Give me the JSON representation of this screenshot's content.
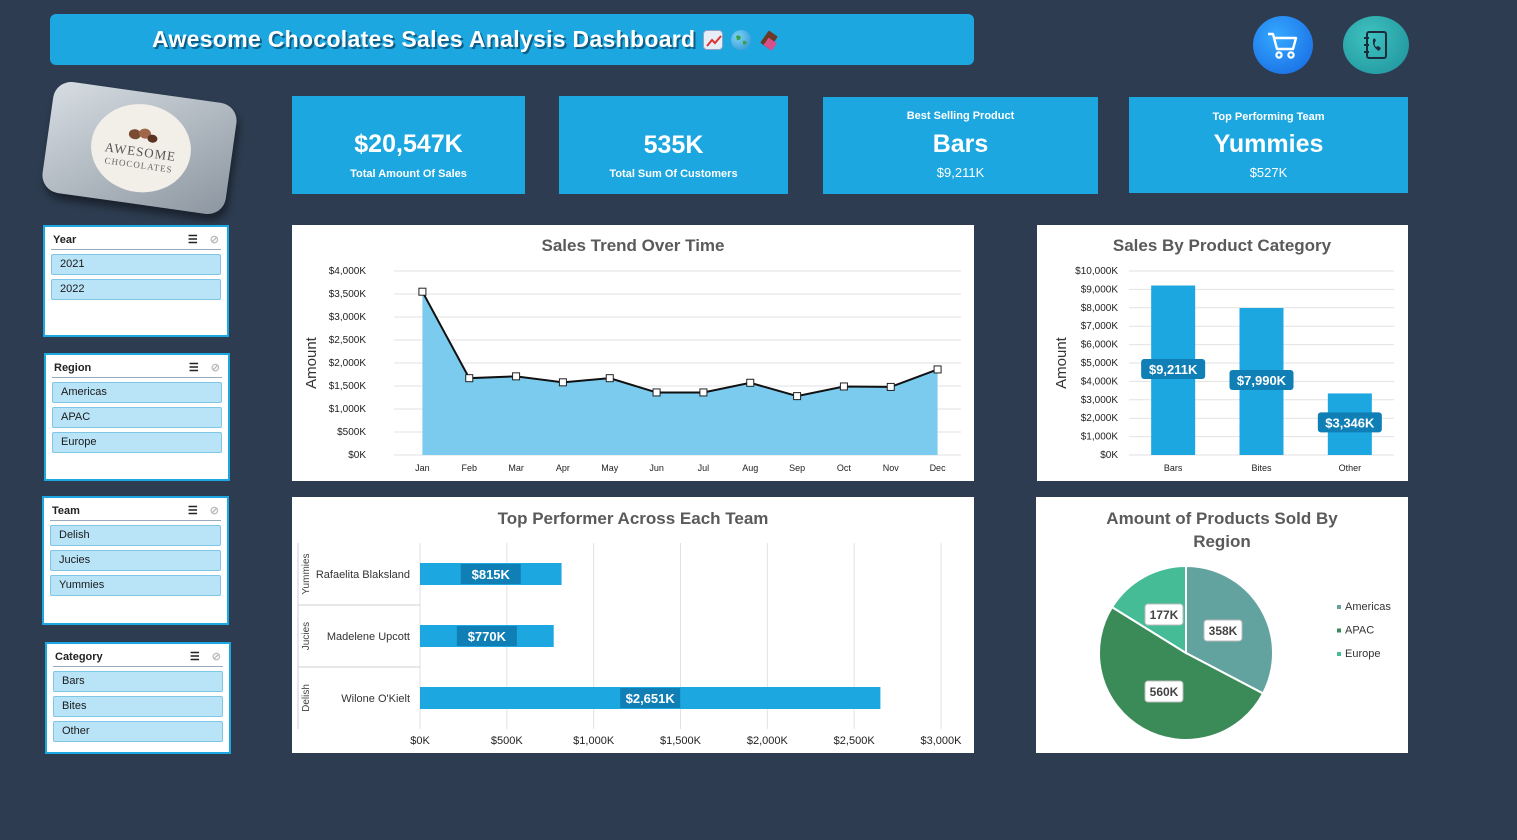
{
  "header": {
    "title": "Awesome Chocolates Sales Analysis Dashboard"
  },
  "icons": {
    "cart": "shopping-cart-icon",
    "contact": "phone-book-icon",
    "chart_emoji": "chart-increasing-icon",
    "globe_emoji": "globe-icon",
    "chocolate_emoji": "chocolate-bar-icon"
  },
  "logo": {
    "line1": "AWESOME",
    "line2": "CHOCOLATES"
  },
  "kpis": {
    "total_sales": {
      "value": "$20,547K",
      "label": "Total Amount Of Sales"
    },
    "total_customers": {
      "value": "535K",
      "label": "Total Sum Of Customers"
    },
    "best_product": {
      "label": "Best Selling Product",
      "value": "Bars",
      "sub": "$9,211K"
    },
    "top_team": {
      "label": "Top Performing Team",
      "value": "Yummies",
      "sub": "$527K"
    }
  },
  "slicers": {
    "year": {
      "title": "Year",
      "items": [
        "2021",
        "2022"
      ]
    },
    "region": {
      "title": "Region",
      "items": [
        "Americas",
        "APAC",
        "Europe"
      ]
    },
    "team": {
      "title": "Team",
      "items": [
        "Delish",
        "Jucies",
        "Yummies"
      ]
    },
    "category": {
      "title": "Category",
      "items": [
        "Bars",
        "Bites",
        "Other"
      ]
    }
  },
  "chart_data": [
    {
      "type": "area",
      "title": "Sales Trend Over Time",
      "ylabel": "Amount",
      "categories": [
        "Jan",
        "Feb",
        "Mar",
        "Apr",
        "May",
        "Jun",
        "Jul",
        "Aug",
        "Sep",
        "Oct",
        "Nov",
        "Dec"
      ],
      "values": [
        3550,
        1670,
        1710,
        1580,
        1670,
        1360,
        1360,
        1570,
        1280,
        1490,
        1480,
        1860
      ],
      "ylim": [
        0,
        4000
      ],
      "yticks": [
        "$0K",
        "$500K",
        "$1,000K",
        "$1,500K",
        "$2,000K",
        "$2,500K",
        "$3,000K",
        "$3,500K",
        "$4,000K"
      ],
      "color": "#7acbee"
    },
    {
      "type": "bar",
      "title": "Sales By Product Category",
      "ylabel": "Amount",
      "categories": [
        "Bars",
        "Bites",
        "Other"
      ],
      "values": [
        9211,
        7990,
        3346
      ],
      "labels": [
        "$9,211K",
        "$7,990K",
        "$3,346K"
      ],
      "ylim": [
        0,
        10000
      ],
      "yticks": [
        "$0K",
        "$1,000K",
        "$2,000K",
        "$3,000K",
        "$4,000K",
        "$5,000K",
        "$6,000K",
        "$7,000K",
        "$8,000K",
        "$9,000K",
        "$10,000K"
      ],
      "color": "#1ca7e0"
    },
    {
      "type": "bar",
      "orientation": "horizontal",
      "title": "Top Performer Across Each  Team",
      "groups": [
        "Yummies",
        "Jucies",
        "Delish"
      ],
      "categories": [
        "Rafaelita Blaksland",
        "Madelene Upcott",
        "Wilone O'Kielt"
      ],
      "values": [
        815,
        770,
        2651
      ],
      "labels": [
        "$815K",
        "$770K",
        "$2,651K"
      ],
      "xlim": [
        0,
        3000
      ],
      "xticks": [
        "$0K",
        "$500K",
        "$1,000K",
        "$1,500K",
        "$2,000K",
        "$2,500K",
        "$3,000K"
      ],
      "color": "#1ca7e0"
    },
    {
      "type": "pie",
      "title": "Amount of Products Sold By Region",
      "categories": [
        "Americas",
        "APAC",
        "Europe"
      ],
      "values": [
        358,
        560,
        177
      ],
      "labels": [
        "358K",
        "560K",
        "177K"
      ],
      "colors": [
        "#62a39f",
        "#3a8b58",
        "#45bc96"
      ]
    }
  ]
}
